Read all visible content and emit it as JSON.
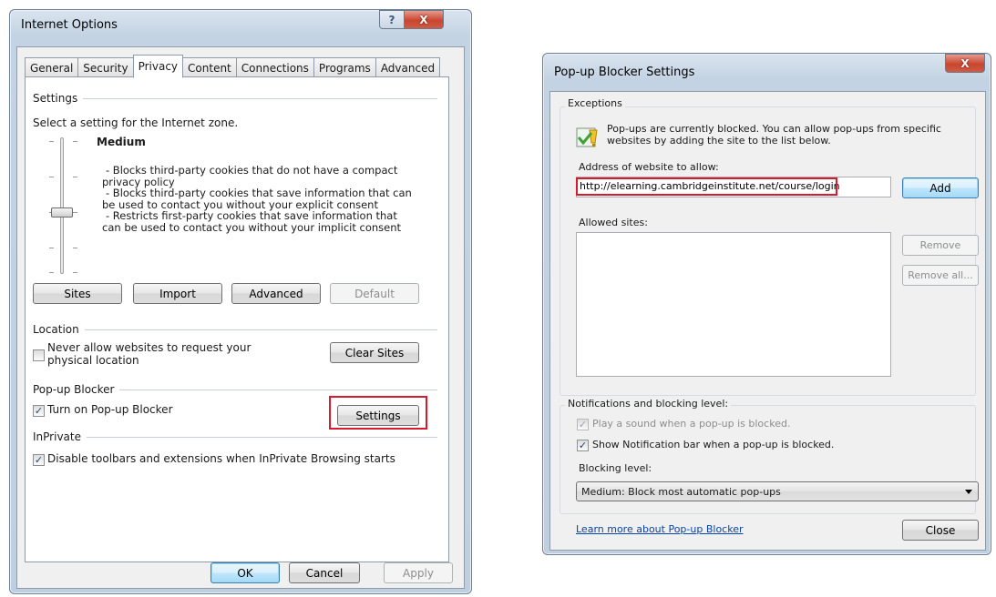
{
  "internet_options": {
    "title": "Internet Options",
    "help_glyph": "?",
    "close_glyph": "X",
    "tabs": [
      {
        "label": "General"
      },
      {
        "label": "Security"
      },
      {
        "label": "Privacy"
      },
      {
        "label": "Content"
      },
      {
        "label": "Connections"
      },
      {
        "label": "Programs"
      },
      {
        "label": "Advanced"
      }
    ],
    "settings": {
      "heading": "Settings",
      "description": "Select a setting for the Internet zone.",
      "level": "Medium",
      "bullets": [
        "- Blocks third-party cookies that do not have a compact",
        "privacy policy",
        "- Blocks third-party cookies that save information that can",
        "be used to contact you without your explicit consent",
        "- Restricts first-party cookies that save information that",
        "can be used to contact you without your implicit consent"
      ],
      "buttons": {
        "sites": "Sites",
        "import": "Import",
        "advanced": "Advanced",
        "default": "Default"
      }
    },
    "location": {
      "heading": "Location",
      "checkbox_line1": "Never allow websites to request your",
      "checkbox_line2": "physical location",
      "checked": false,
      "clear_sites": "Clear Sites"
    },
    "popup_blocker": {
      "heading": "Pop-up Blocker",
      "checkbox_label": "Turn on Pop-up Blocker",
      "checked": true,
      "settings_button": "Settings"
    },
    "inprivate": {
      "heading": "InPrivate",
      "checkbox_label": "Disable toolbars and extensions when InPrivate Browsing starts",
      "checked": true
    },
    "footer": {
      "ok": "OK",
      "cancel": "Cancel",
      "apply": "Apply"
    }
  },
  "popup_settings": {
    "title": "Pop-up Blocker Settings",
    "close_glyph": "X",
    "exceptions": {
      "heading": "Exceptions",
      "info_line1": "Pop-ups are currently blocked.  You can allow pop-ups from specific",
      "info_line2": "websites by adding the site to the list below.",
      "address_label": "Address of website to allow:",
      "address_value": "http://elearning.cambridgeinstitute.net/course/login",
      "add_button": "Add",
      "allowed_label": "Allowed sites:",
      "remove_button": "Remove",
      "remove_all_button": "Remove all..."
    },
    "notifications": {
      "heading": "Notifications and blocking level:",
      "play_sound": "Play a sound when a pop-up is blocked.",
      "play_sound_checked": true,
      "show_bar": "Show Notification bar when a pop-up is blocked.",
      "show_bar_checked": true,
      "blocking_label": "Blocking level:",
      "blocking_value": "Medium: Block most automatic pop-ups"
    },
    "footer": {
      "learn_more": "Learn more about Pop-up Blocker",
      "close": "Close"
    }
  },
  "colors": {
    "highlight": "#d81b2c",
    "link": "#0645ad"
  }
}
